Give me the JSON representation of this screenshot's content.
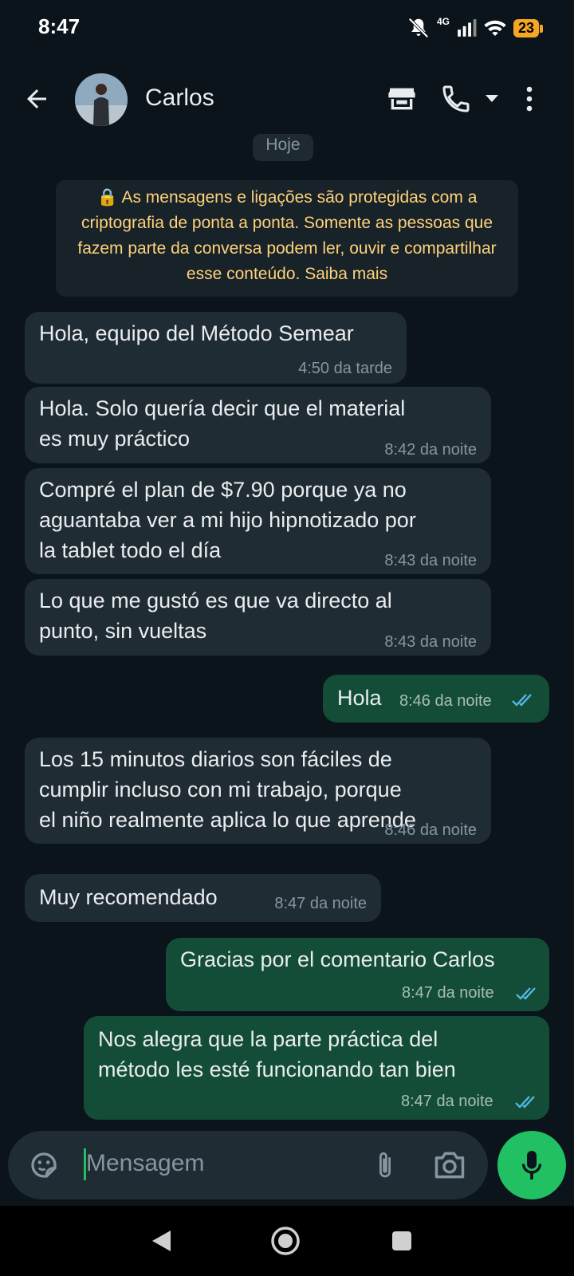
{
  "status_bar": {
    "time": "8:47",
    "network": "4G",
    "battery": "23"
  },
  "header": {
    "contact_name": "Carlos"
  },
  "date_separator": "Hoje",
  "encryption_notice": "🔒 As mensagens e ligações são protegidas com a criptografia de ponta a ponta. Somente as pessoas que fazem parte da conversa podem ler, ouvir e compartilhar esse conteúdo. Saiba mais",
  "messages": [
    {
      "direction": "incoming",
      "text": "Hola, equipo del Método Semear",
      "time": "4:50 da tarde"
    },
    {
      "direction": "incoming",
      "text": "Hola. Solo quería decir que el material\nes muy práctico",
      "time": "8:42 da noite"
    },
    {
      "direction": "incoming",
      "text": "Compré el plan de $7.90 porque ya no\naguantaba ver a mi hijo hipnotizado por\nla tablet todo el día",
      "time": "8:43 da noite"
    },
    {
      "direction": "incoming",
      "text": "Lo que me gustó es que va directo al\npunto, sin vueltas",
      "time": "8:43 da noite"
    },
    {
      "direction": "outgoing",
      "text": "Hola",
      "time": "8:46 da noite"
    },
    {
      "direction": "incoming",
      "text": "Los 15 minutos diarios son fáciles de\ncumplir incluso con mi trabajo, porque\nel niño realmente aplica lo que aprende",
      "time": "8:46 da noite"
    },
    {
      "direction": "incoming",
      "text": "Muy recomendado",
      "time": "8:47 da noite"
    },
    {
      "direction": "outgoing",
      "text": "Gracias por el comentario Carlos",
      "time": "8:47 da noite"
    },
    {
      "direction": "outgoing",
      "text": "Nos alegra que la parte práctica del\nmétodo les esté funcionando tan bien",
      "time": "8:47 da noite"
    }
  ],
  "composer": {
    "placeholder": "Mensagem"
  },
  "colors": {
    "incoming": "#202c33",
    "outgoing": "#144d37",
    "accent": "#21c063",
    "read_ticks": "#53bdeb"
  }
}
